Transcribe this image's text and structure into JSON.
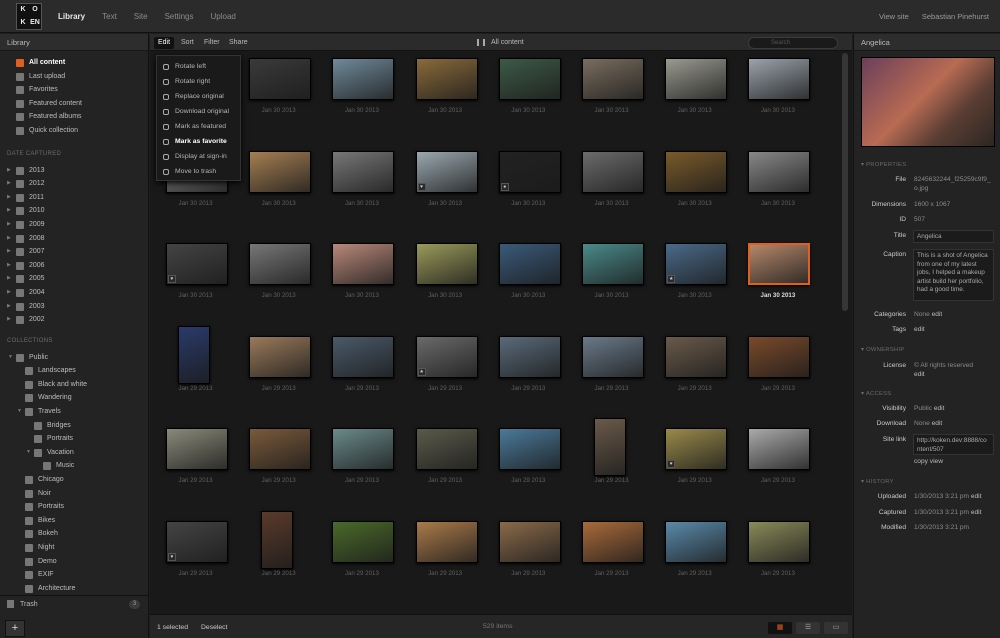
{
  "app": {
    "logo": [
      "K",
      "O",
      "K",
      "EN"
    ],
    "nav": [
      "Library",
      "Text",
      "Site",
      "Settings",
      "Upload"
    ],
    "nav_active": "Library",
    "view_site": "View site",
    "user": "Sebastian Pinehurst"
  },
  "sidebar": {
    "title": "Library",
    "library_items": [
      {
        "label": "All content",
        "icon": "library-icon",
        "selected": true
      },
      {
        "label": "Last upload",
        "icon": "clock-icon"
      },
      {
        "label": "Favorites",
        "icon": "heart-icon"
      },
      {
        "label": "Featured content",
        "icon": "star-icon"
      },
      {
        "label": "Featured albums",
        "icon": "album-icon"
      },
      {
        "label": "Quick collection",
        "icon": "bolt-icon"
      }
    ],
    "date_header": "DATE CAPTURED",
    "years": [
      "2013",
      "2012",
      "2011",
      "2010",
      "2009",
      "2008",
      "2007",
      "2006",
      "2005",
      "2004",
      "2003",
      "2002"
    ],
    "collections_header": "COLLECTIONS",
    "collections": [
      {
        "label": "Public",
        "depth": 0,
        "expanded": true
      },
      {
        "label": "Landscapes",
        "depth": 1
      },
      {
        "label": "Black and white",
        "depth": 1
      },
      {
        "label": "Wandering",
        "depth": 1
      },
      {
        "label": "Travels",
        "depth": 1,
        "expanded": true
      },
      {
        "label": "Bridges",
        "depth": 2
      },
      {
        "label": "Portraits",
        "depth": 2
      },
      {
        "label": "Vacation",
        "depth": 2,
        "expanded": true
      },
      {
        "label": "Music",
        "depth": 3
      },
      {
        "label": "Chicago",
        "depth": 1
      },
      {
        "label": "Noir",
        "depth": 1
      },
      {
        "label": "Portraits",
        "depth": 1
      },
      {
        "label": "Bikes",
        "depth": 1
      },
      {
        "label": "Bokeh",
        "depth": 1
      },
      {
        "label": "Night",
        "depth": 1
      },
      {
        "label": "Demo",
        "depth": 1
      },
      {
        "label": "EXIF",
        "depth": 1
      },
      {
        "label": "Architecture",
        "depth": 1
      }
    ],
    "trash": {
      "label": "Trash",
      "count": "3"
    },
    "add": "+"
  },
  "toolbar": {
    "tabs": [
      "Edit",
      "Sort",
      "Filter",
      "Share"
    ],
    "active_tab": "Edit",
    "title": "All content",
    "search_placeholder": "Search"
  },
  "edit_menu": [
    {
      "label": "Rotate left",
      "icon": "rotate-left-icon"
    },
    {
      "label": "Rotate right",
      "icon": "rotate-right-icon"
    },
    {
      "label": "Replace original",
      "icon": "replace-icon"
    },
    {
      "label": "Download original",
      "icon": "download-icon"
    },
    {
      "label": "Mark as featured",
      "icon": "star-icon"
    },
    {
      "label": "Mark as favorite",
      "icon": "heart-icon",
      "highlighted": true
    },
    {
      "label": "Display at sign-in",
      "icon": "display-icon"
    },
    {
      "label": "Move to trash",
      "icon": "trash-icon"
    }
  ],
  "grid": {
    "rows": [
      {
        "date": "Jan 30 2013",
        "items": [
          {
            "c": "#555"
          },
          {
            "c": "#3a3a3a"
          },
          {
            "c": "#6f8a9a"
          },
          {
            "c": "#8a6a3a"
          },
          {
            "c": "#3d5a46"
          },
          {
            "c": "#7a6d5e"
          },
          {
            "c": "#9a9a90"
          },
          {
            "c": "#9aa3ab"
          }
        ]
      },
      {
        "date": "Jan 30 2013",
        "items": [
          {
            "c": "#888"
          },
          {
            "c": "#a57f52"
          },
          {
            "c": "#777"
          },
          {
            "c": "#9aa8b0",
            "b": "heart"
          },
          {
            "c": "#222",
            "b": "cam"
          },
          {
            "c": "#6b6b6b"
          },
          {
            "c": "#7a5a2a"
          },
          {
            "c": "#888"
          }
        ]
      },
      {
        "date": "Jan 30 2013",
        "items": [
          {
            "c": "#444",
            "b": "heart"
          },
          {
            "c": "#777"
          },
          {
            "c": "#b9887a"
          },
          {
            "c": "#9a9a5a"
          },
          {
            "c": "#3a5a7a"
          },
          {
            "c": "#4a8a8a"
          },
          {
            "c": "#4a6a8a",
            "b": "star"
          },
          {
            "c": "#b4876a",
            "sel": true
          }
        ]
      },
      {
        "date": "Jan 29 2013",
        "items": [
          {
            "c": "#2a3a6a",
            "p": true
          },
          {
            "c": "#9a7a5a"
          },
          {
            "c": "#4a5a6a"
          },
          {
            "c": "#6a6a6a",
            "b": "star"
          },
          {
            "c": "#5a6a7a"
          },
          {
            "c": "#6a7a8a"
          },
          {
            "c": "#6a5a4a"
          },
          {
            "c": "#7a4a2a"
          }
        ]
      },
      {
        "date": "Jan 29 2013",
        "items": [
          {
            "c": "#8a8a7a"
          },
          {
            "c": "#7a5a3a"
          },
          {
            "c": "#6a8a8a"
          },
          {
            "c": "#5a5a4a"
          },
          {
            "c": "#4a7a9a"
          },
          {
            "c": "#6a5a4a",
            "p": true
          },
          {
            "c": "#9a8a4a",
            "b": "heart"
          },
          {
            "c": "#aaa"
          }
        ]
      },
      {
        "date": "Jan 29 2013",
        "items": [
          {
            "c": "#444",
            "b": "heart"
          },
          {
            "c": "#5a3a2a",
            "p": true
          },
          {
            "c": "#4a6a2a"
          },
          {
            "c": "#aa7a4a"
          },
          {
            "c": "#8a6a4a"
          },
          {
            "c": "#aa6a3a"
          },
          {
            "c": "#5a8aaa"
          },
          {
            "c": "#8a8a5a"
          }
        ]
      }
    ]
  },
  "bottom": {
    "selected": "1 selected",
    "deselect": "Deselect",
    "item_count": "529 items"
  },
  "inspector": {
    "title": "Angelica",
    "properties_header": "PROPERTIES",
    "file_label": "File",
    "file": "8245632244_f25259c9f9_o.jpg",
    "dimensions_label": "Dimensions",
    "dimensions": "1600 x 1067",
    "id_label": "ID",
    "id": "507",
    "title_label": "Title",
    "caption_label": "Caption",
    "caption": "This is a shot of Angelica from one of my latest jobs, I helped a makeup artist build her portfolio, had a good time.",
    "categories_label": "Categories",
    "categories": "None",
    "tags_label": "Tags",
    "edit": "edit",
    "ownership_header": "OWNERSHIP",
    "license_label": "License",
    "license": "© All rights reserved",
    "access_header": "ACCESS",
    "visibility_label": "Visibility",
    "visibility": "Public",
    "download_label": "Download",
    "download": "None",
    "sitelink_label": "Site link",
    "sitelink": "http://koken.dev:8888/content/507",
    "copy": "copy",
    "view": "view",
    "history_header": "HISTORY",
    "uploaded_label": "Uploaded",
    "uploaded": "1/30/2013 3:21 pm",
    "captured_label": "Captured",
    "captured": "1/30/2013 3:21 pm",
    "modified_label": "Modified",
    "modified": "1/30/2013 3:21 pm"
  }
}
